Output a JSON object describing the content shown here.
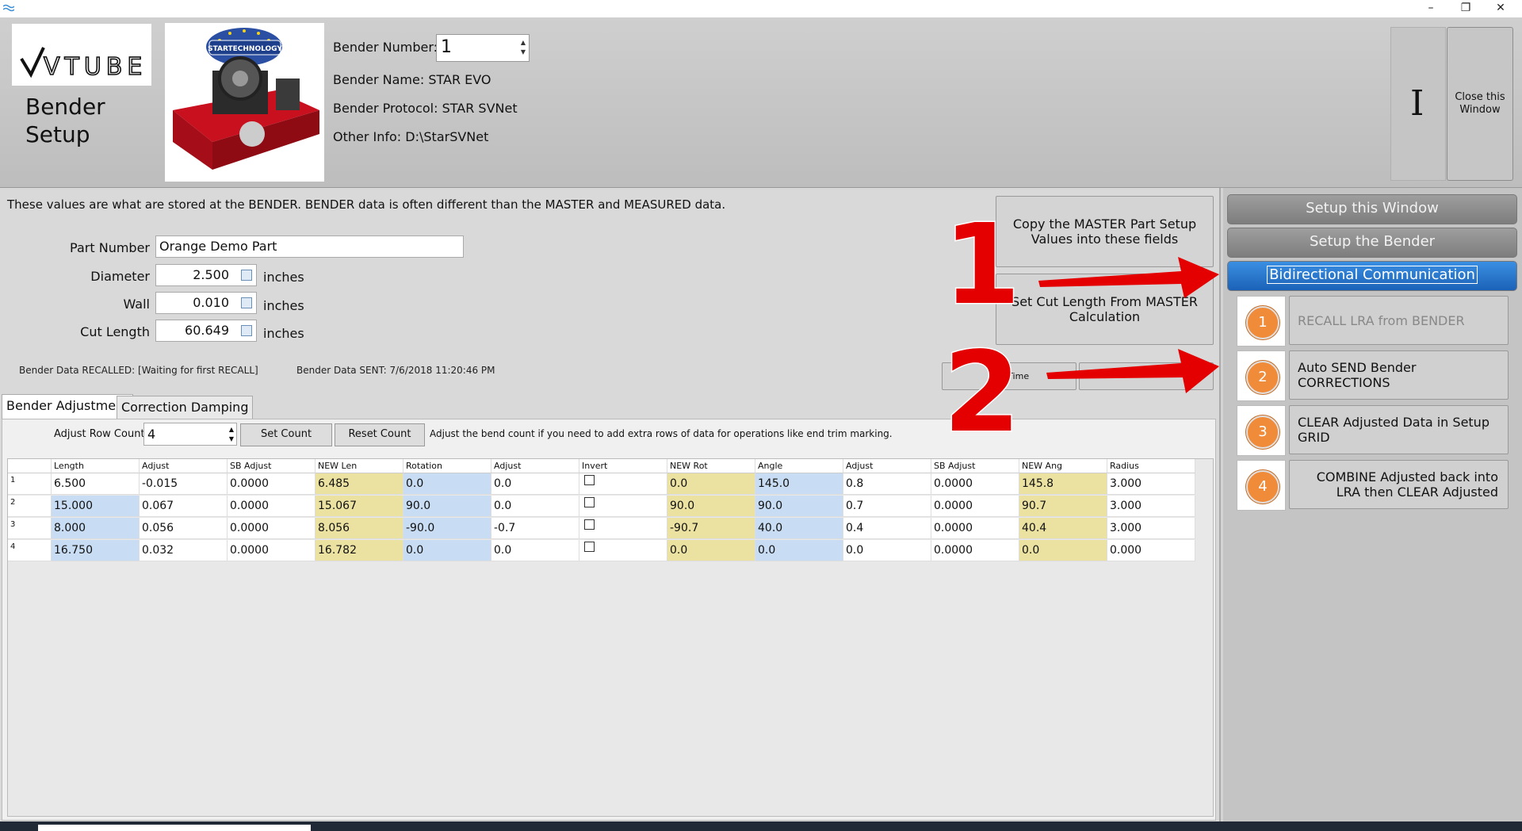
{
  "window": {
    "controls": {
      "minimize": "–",
      "restore": "❐",
      "close": "✕"
    }
  },
  "header": {
    "logo_text": "VTUBE",
    "title": "Bender\nSetup",
    "brand_badge": "STARTECHNOLOGY",
    "bender_number_label": "Bender Number:",
    "bender_number_value": "1",
    "bender_name_label": "Bender Name:",
    "bender_name_value": "STAR EVO",
    "bender_protocol_label": "Bender Protocol:",
    "bender_protocol_value": "STAR SVNet",
    "other_info_label": "Other Info:",
    "other_info_value": "D:\\StarSVNet",
    "cursor_glyph": "I",
    "close_window_label": "Close this Window"
  },
  "main": {
    "info_text": "These values are what are stored at the BENDER.  BENDER data is often different than the MASTER and MEASURED data.",
    "fields": {
      "part_number_label": "Part Number",
      "part_number_value": "Orange Demo Part",
      "diameter_label": "Diameter",
      "diameter_value": "2.500",
      "wall_label": "Wall",
      "wall_value": "0.010",
      "cut_length_label": "Cut Length",
      "cut_length_value": "60.649",
      "unit": "inches"
    },
    "buttons": {
      "copy_master": "Copy the MASTER Part Setup Values into these fields",
      "set_cut_length": "Set Cut Length From MASTER Calculation",
      "recall_time_partial": "ALL Time"
    },
    "status": {
      "recalled_label": "Bender Data RECALLED:",
      "recalled_value": "[Waiting for first RECALL]",
      "sent_label": "Bender Data SENT:",
      "sent_value": "7/6/2018 11:20:46 PM"
    },
    "tabs": [
      "Bender Adjustment",
      "Correction Damping"
    ],
    "adjust": {
      "row_count_label": "Adjust Row Count:",
      "row_count_value": "4",
      "set_count": "Set Count",
      "reset_count": "Reset Count",
      "hint": "Adjust the bend count if you need to add extra rows of data for operations like end trim marking."
    }
  },
  "grid": {
    "columns": [
      "Length",
      "Adjust",
      "SB Adjust",
      "NEW Len",
      "Rotation",
      "Adjust",
      "Invert",
      "NEW Rot",
      "Angle",
      "Adjust",
      "SB Adjust",
      "NEW Ang",
      "Radius"
    ],
    "rows": [
      {
        "num": "1",
        "cells": [
          "6.500",
          "-0.015",
          "0.0000",
          "6.485",
          "0.0",
          "0.0",
          "",
          "0.0",
          "145.0",
          "0.8",
          "0.0000",
          "145.8",
          "3.000"
        ]
      },
      {
        "num": "2",
        "cells": [
          "15.000",
          "0.067",
          "0.0000",
          "15.067",
          "90.0",
          "0.0",
          "",
          "90.0",
          "90.0",
          "0.7",
          "0.0000",
          "90.7",
          "3.000"
        ]
      },
      {
        "num": "3",
        "cells": [
          "8.000",
          "0.056",
          "0.0000",
          "8.056",
          "-90.0",
          "-0.7",
          "",
          "-90.7",
          "40.0",
          "0.4",
          "0.0000",
          "40.4",
          "3.000"
        ]
      },
      {
        "num": "4",
        "cells": [
          "16.750",
          "0.032",
          "0.0000",
          "16.782",
          "0.0",
          "0.0",
          "",
          "0.0",
          "0.0",
          "0.0",
          "0.0000",
          "0.0",
          "0.000"
        ]
      }
    ]
  },
  "right_panel": {
    "nav": [
      "Setup this Window",
      "Setup the Bender",
      "Bidirectional Communication"
    ],
    "steps": [
      {
        "num": "1",
        "label": "RECALL LRA from BENDER"
      },
      {
        "num": "2",
        "label": "Auto SEND Bender CORRECTIONS"
      },
      {
        "num": "3",
        "label": "CLEAR Adjusted Data in Setup GRID"
      },
      {
        "num": "4",
        "label": "COMBINE Adjusted back into LRA then CLEAR Adjusted"
      }
    ]
  },
  "callouts": [
    "1",
    "2"
  ],
  "colors": {
    "accent_blue": "#1b62b8",
    "step_orange": "#f08b3a",
    "callout_red": "#e40000",
    "highlight_yellow": "#ebe2a2",
    "highlight_blue": "#c8ddf4"
  }
}
